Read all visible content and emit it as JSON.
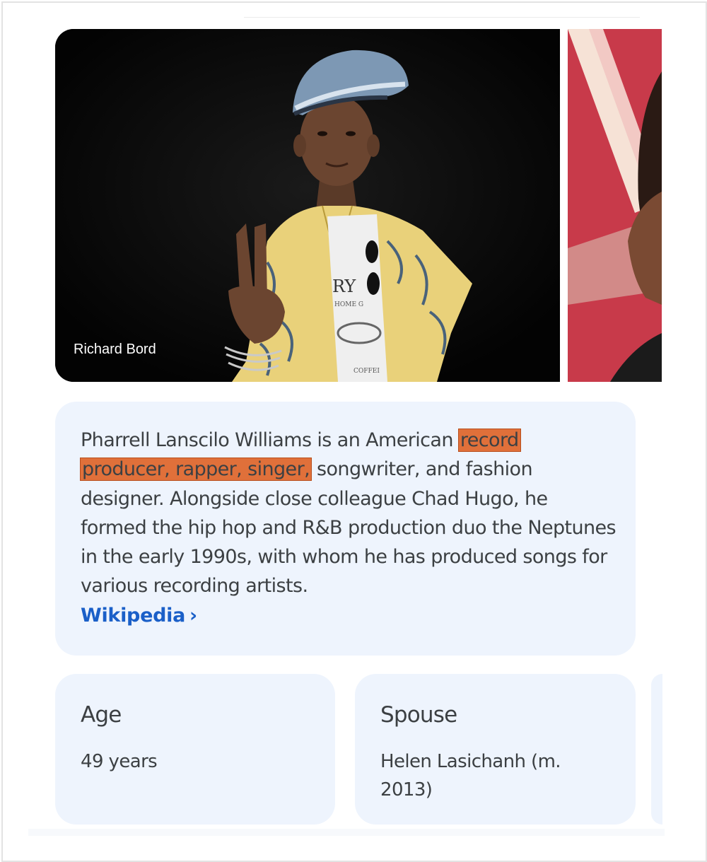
{
  "images": {
    "main_credit": "Richard Bord",
    "shirt_text_top": "RY",
    "shirt_text_mid": "HOME G",
    "shirt_text_bottom": "COFFEI"
  },
  "description": {
    "part1": "Pharrell Lanscilo Williams is an American ",
    "highlight1": "record",
    "highlight2": "producer, rapper, singer,",
    "part2": " songwriter, and fashion designer. Alongside close colleague Chad Hugo, he formed the hip hop and R&B production duo the Neptunes in the early 1990s, with whom he has produced songs for various recording artists.",
    "source_link": "Wikipedia",
    "source_chevron": "›",
    "highlight_color": "#e0703a"
  },
  "facts": [
    {
      "title": "Age",
      "value": "49 years"
    },
    {
      "title": "Spouse",
      "value": "Helen Lasichanh (m. 2013)"
    }
  ],
  "colors": {
    "card_background": "#eef4fd",
    "link": "#1a5fc8",
    "text": "#3c4043"
  }
}
